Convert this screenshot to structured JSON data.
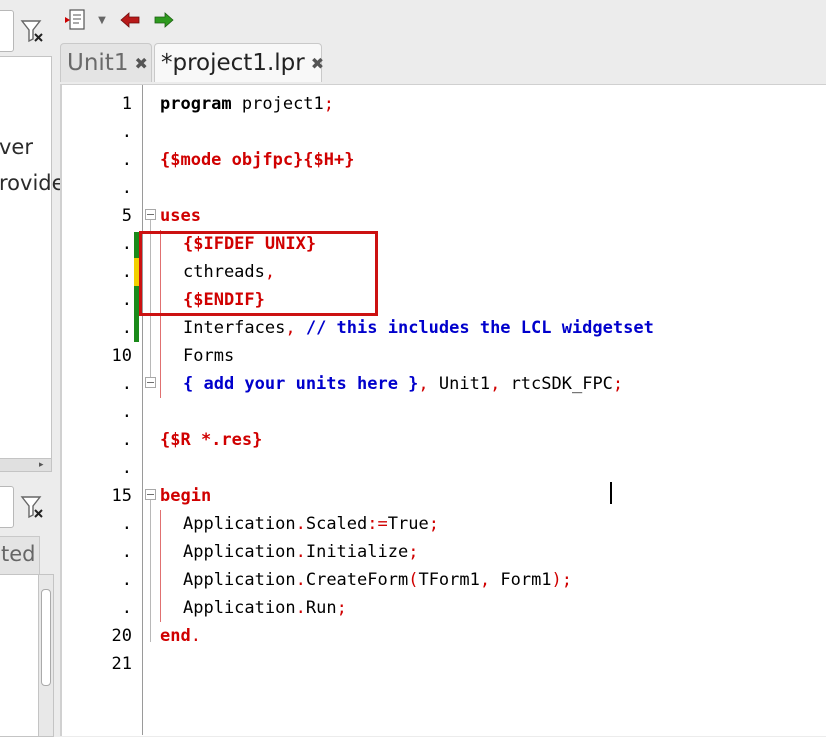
{
  "left_panel": {
    "partial_text_1": "ver",
    "partial_text_2": "rovide",
    "partial_tab": "ted"
  },
  "tabs": [
    {
      "label": "Unit1",
      "active": false
    },
    {
      "label": "*project1.lpr",
      "active": true
    }
  ],
  "editor": {
    "lines": [
      {
        "gutter": "1"
      },
      {
        "gutter": "."
      },
      {
        "gutter": "."
      },
      {
        "gutter": "."
      },
      {
        "gutter": "5"
      },
      {
        "gutter": "."
      },
      {
        "gutter": "."
      },
      {
        "gutter": "."
      },
      {
        "gutter": "."
      },
      {
        "gutter": "10"
      },
      {
        "gutter": "."
      },
      {
        "gutter": "."
      },
      {
        "gutter": "."
      },
      {
        "gutter": "."
      },
      {
        "gutter": "15"
      },
      {
        "gutter": "."
      },
      {
        "gutter": "."
      },
      {
        "gutter": "."
      },
      {
        "gutter": "."
      },
      {
        "gutter": "20"
      },
      {
        "gutter": "21"
      }
    ],
    "code": {
      "l1_kw": "program",
      "l1_rest": " project1",
      "l1_semi": ";",
      "l3": "{$mode objfpc}{$H+}",
      "l5": "uses",
      "l6": "{$IFDEF UNIX}",
      "l7_name": "cthreads",
      "l7_comma": ",",
      "l8": "{$ENDIF}",
      "l9_name": "Interfaces",
      "l9_comma": ",",
      "l9_comment": " // this includes the LCL widgetset",
      "l10": "Forms",
      "l11_comment": "{ add your units here }",
      "l11_c1": ",",
      "l11_unit1": " Unit1",
      "l11_c2": ",",
      "l11_unit2": " rtcSDK_FPC",
      "l11_semi": ";",
      "l13": "{$R *.res}",
      "l15": "begin",
      "l16_a": "Application",
      "l16_dot": ".",
      "l16_b": "Scaled",
      "l16_op": ":=",
      "l16_c": "True",
      "l16_semi": ";",
      "l17_a": "Application",
      "l17_dot": ".",
      "l17_b": "Initialize",
      "l17_semi": ";",
      "l18_a": "Application",
      "l18_dot": ".",
      "l18_b": "CreateForm",
      "l18_p1": "(",
      "l18_c": "TForm1",
      "l18_comma": ",",
      "l18_d": " Form1",
      "l18_p2": ")",
      "l18_semi": ";",
      "l19_a": "Application",
      "l19_dot": ".",
      "l19_b": "Run",
      "l19_semi": ";",
      "l20_kw": "end",
      "l20_dot": "."
    }
  },
  "colors": {
    "keyword_red": "#d00000",
    "comment_blue": "#0000cc",
    "highlight_box": "#cc1111",
    "change_green": "#1a8a1a",
    "change_yellow": "#f2d000"
  },
  "icons": [
    "filter-clear-icon",
    "jump-list-icon",
    "back-arrow-icon",
    "forward-arrow-icon",
    "close-tab-icon"
  ]
}
